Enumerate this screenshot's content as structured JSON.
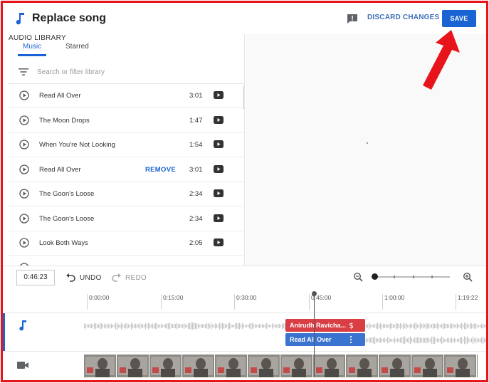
{
  "header": {
    "title": "Replace song",
    "discard_label": "DISCARD CHANGES",
    "save_label": "SAVE"
  },
  "tabs": {
    "music": "Music",
    "starred": "Starred",
    "library": "AUDIO LIBRARY"
  },
  "search": {
    "placeholder": "Search or filter library"
  },
  "tracks": [
    {
      "title": "Read All Over",
      "action": "",
      "duration": "3:01"
    },
    {
      "title": "The Moon Drops",
      "action": "",
      "duration": "1:47"
    },
    {
      "title": "When You're Not Looking",
      "action": "",
      "duration": "1:54"
    },
    {
      "title": "Read All Over",
      "action": "REMOVE",
      "duration": "3:01"
    },
    {
      "title": "The Goon's Loose",
      "action": "",
      "duration": "2:34"
    },
    {
      "title": "The Goon's Loose",
      "action": "",
      "duration": "2:34"
    },
    {
      "title": "Look Both Ways",
      "action": "",
      "duration": "2:05"
    }
  ],
  "toolbar": {
    "timecode": "0:46:23",
    "undo_label": "UNDO",
    "redo_label": "REDO"
  },
  "ruler": {
    "labels": [
      "0:00:00",
      "0:15:00",
      "0:30:00",
      "0:45:00",
      "1:00:00",
      "1:19:22"
    ]
  },
  "clips": {
    "artist_clip": "Anirudh Ravicha...",
    "song_clip": "Read All Over"
  },
  "colors": {
    "accent": "#1a63d3",
    "frame": "#e8141b",
    "artist_clip": "#d93e45",
    "song_clip": "#3a74d0"
  },
  "icons": {
    "header": [
      "music-note-icon",
      "feedback-icon"
    ],
    "track": [
      "play-circle-icon",
      "youtube-icon"
    ],
    "toolbar": [
      "undo-icon",
      "redo-icon",
      "zoom-out-icon",
      "zoom-in-icon"
    ],
    "timeline": [
      "music-note-icon",
      "camera-icon"
    ]
  }
}
